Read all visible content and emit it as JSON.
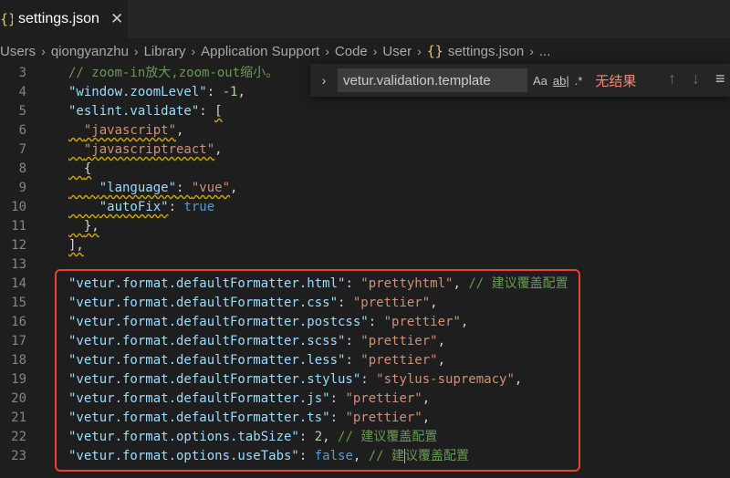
{
  "tab": {
    "icon": "json-icon",
    "label": "settings.json",
    "close": "✕"
  },
  "breadcrumb": {
    "items": [
      "Users",
      "qiongyanzhu",
      "Library",
      "Application Support",
      "Code",
      "User",
      "settings.json",
      "..."
    ],
    "file_icon": "{}"
  },
  "find": {
    "value": "vetur.validation.template",
    "option_case": "Aa",
    "option_word": "ab|",
    "option_regex": ".*",
    "result": "无结果",
    "prev": "↑",
    "next": "↓"
  },
  "lines": [
    {
      "num": "3"
    },
    {
      "num": "4"
    },
    {
      "num": "5"
    },
    {
      "num": "6"
    },
    {
      "num": "7"
    },
    {
      "num": "8"
    },
    {
      "num": "9"
    },
    {
      "num": "10"
    },
    {
      "num": "11"
    },
    {
      "num": "12"
    },
    {
      "num": "13"
    },
    {
      "num": "14"
    },
    {
      "num": "15"
    },
    {
      "num": "16"
    },
    {
      "num": "17"
    },
    {
      "num": "18"
    },
    {
      "num": "19"
    },
    {
      "num": "20"
    },
    {
      "num": "21"
    },
    {
      "num": "22"
    },
    {
      "num": "23"
    }
  ],
  "code": {
    "l3c": "// zoom-in放大,zoom-out缩小。",
    "l4k": "\"window.zoomLevel\"",
    "l4v": "-1",
    "l5k": "\"eslint.validate\"",
    "l5v": "[",
    "l6": "\"javascript\"",
    "l7": "\"javascriptreact\"",
    "l8": "{",
    "l9k": "\"language\"",
    "l9v": "\"vue\"",
    "l10k": "\"autoFix\"",
    "l10v": "true",
    "l11": "},",
    "l12": "],",
    "l14k": "\"vetur.format.defaultFormatter.html\"",
    "l14v": "\"prettyhtml\"",
    "l14c": "// 建议覆盖配置",
    "l15k": "\"vetur.format.defaultFormatter.css\"",
    "l15v": "\"prettier\"",
    "l16k": "\"vetur.format.defaultFormatter.postcss\"",
    "l16v": "\"prettier\"",
    "l17k": "\"vetur.format.defaultFormatter.scss\"",
    "l17v": "\"prettier\"",
    "l18k": "\"vetur.format.defaultFormatter.less\"",
    "l18v": "\"prettier\"",
    "l19k": "\"vetur.format.defaultFormatter.stylus\"",
    "l19v": "\"stylus-supremacy\"",
    "l20k": "\"vetur.format.defaultFormatter.js\"",
    "l20v": "\"prettier\"",
    "l21k": "\"vetur.format.defaultFormatter.ts\"",
    "l21v": "\"prettier\"",
    "l22k": "\"vetur.format.options.tabSize\"",
    "l22v": "2",
    "l22c": "// 建议覆盖配置",
    "l23k": "\"vetur.format.options.useTabs\"",
    "l23v": "false",
    "l23c1": "// 建",
    "l23c2": "议覆盖配置"
  },
  "colors": {
    "highlight": "#e8432e",
    "string": "#ce9178",
    "key": "#9cdcfe",
    "comment": "#6a9955"
  }
}
